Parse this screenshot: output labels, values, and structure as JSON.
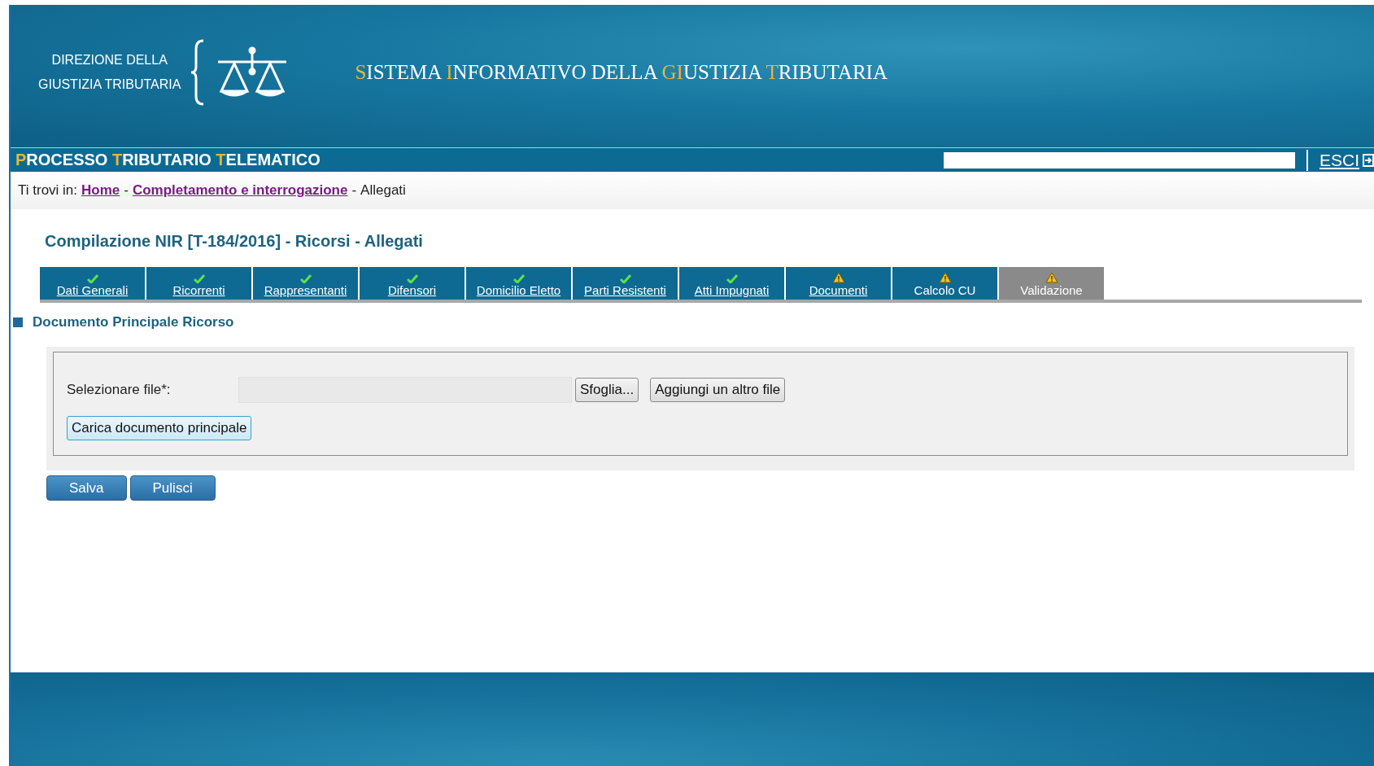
{
  "header": {
    "org_lines": [
      "DIREZIONE DELLA",
      "GIUSTIZIA TRIBUTARIA"
    ],
    "system_title": [
      {
        "text": "S",
        "accent": true
      },
      {
        "text": "ISTEMA ",
        "accent": false
      },
      {
        "text": "I",
        "accent": true
      },
      {
        "text": "NFORMATIVO DELLA ",
        "accent": false
      },
      {
        "text": "GI",
        "accent": true
      },
      {
        "text": "USTIZIA ",
        "accent": false
      },
      {
        "text": "T",
        "accent": true
      },
      {
        "text": "RIBUTARIA",
        "accent": false
      }
    ]
  },
  "app_bar": {
    "title": [
      {
        "text": "P",
        "accent": true
      },
      {
        "text": "ROCESSO ",
        "accent": false
      },
      {
        "text": "T",
        "accent": true
      },
      {
        "text": "RIBUTARIO ",
        "accent": false
      },
      {
        "text": "T",
        "accent": true
      },
      {
        "text": "ELEMATICO",
        "accent": false
      }
    ],
    "exit_label": "ESCI"
  },
  "breadcrumb": {
    "prefix": "Ti trovi in:",
    "items": [
      {
        "label": "Home",
        "link": true
      },
      {
        "label": "Completamento e interrogazione",
        "link": true
      },
      {
        "label": "Allegati",
        "link": false
      }
    ],
    "separator": "-"
  },
  "page_title": "Compilazione NIR [T-184/2016] - Ricorsi - Allegati",
  "tabs": [
    {
      "label": "Dati Generali",
      "kind": "ok",
      "link": true,
      "selected": false
    },
    {
      "label": "Ricorrenti",
      "kind": "ok",
      "link": true,
      "selected": false
    },
    {
      "label": "Rappresentanti",
      "kind": "ok",
      "link": true,
      "selected": false
    },
    {
      "label": "Difensori",
      "kind": "ok",
      "link": true,
      "selected": false
    },
    {
      "label": "Domicilio Eletto",
      "kind": "ok",
      "link": true,
      "selected": false
    },
    {
      "label": "Parti Resistenti",
      "kind": "ok",
      "link": true,
      "selected": false
    },
    {
      "label": "Atti Impugnati",
      "kind": "ok",
      "link": true,
      "selected": false
    },
    {
      "label": "Documenti",
      "kind": "warning",
      "link": true,
      "selected": false
    },
    {
      "label": "Calcolo CU",
      "kind": "warning",
      "link": false,
      "selected": false
    },
    {
      "label": "Validazione",
      "kind": "warning",
      "link": false,
      "selected": true
    }
  ],
  "section": {
    "title": "Documento Principale Ricorso",
    "file_label": "Selezionare file*:",
    "browse_button": "Sfoglia...",
    "add_file_button": "Aggiungi un altro file",
    "upload_button": "Carica documento principale"
  },
  "actions": [
    "Salva",
    "Pulisci"
  ]
}
